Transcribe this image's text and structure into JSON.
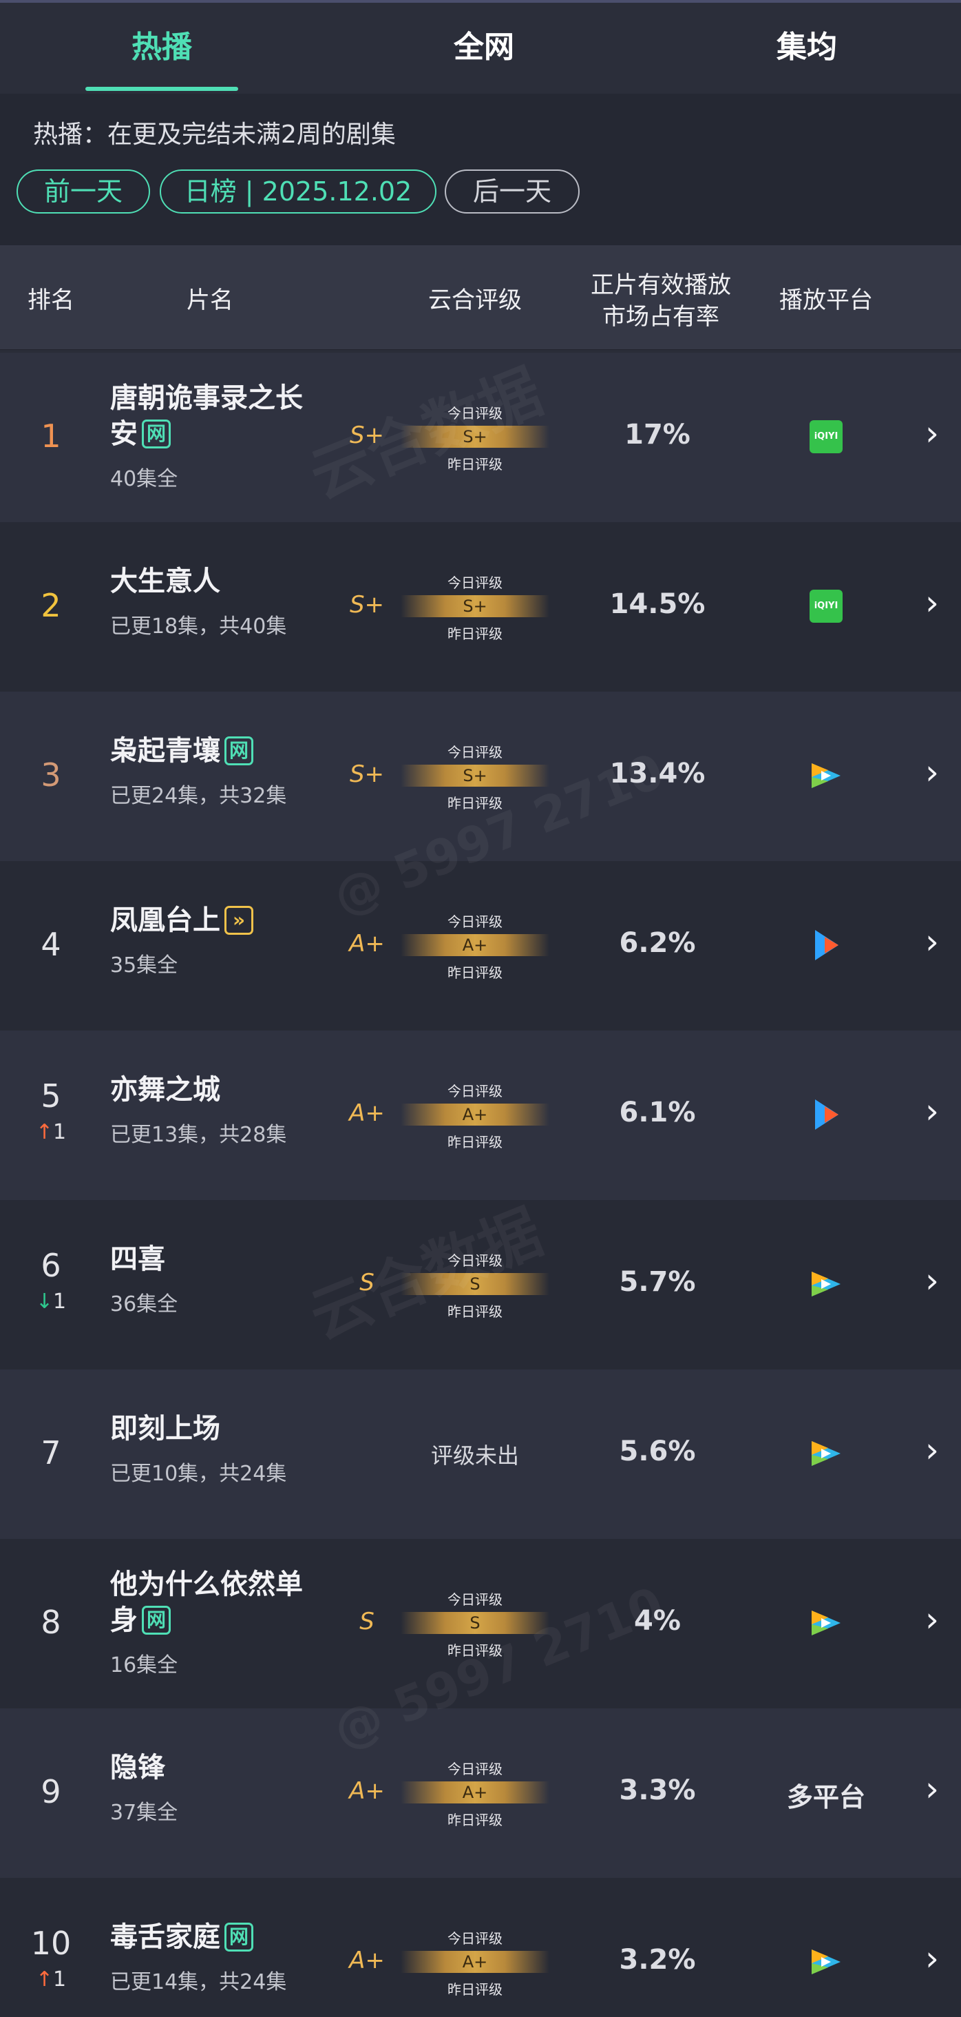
{
  "tabs": [
    {
      "label": "热播",
      "active": true
    },
    {
      "label": "全网",
      "active": false
    },
    {
      "label": "集均",
      "active": false
    }
  ],
  "subtitle": "热播：在更及完结未满2周的剧集",
  "date_nav": {
    "prev": "前一天",
    "current": "日榜 | 2025.12.02",
    "next": "后一天"
  },
  "columns": {
    "rank": "排名",
    "title": "片名",
    "grade": "云合评级",
    "share_line1": "正片有效播放",
    "share_line2": "市场占有率",
    "platform": "播放平台"
  },
  "grade_labels": {
    "today": "今日评级",
    "yesterday": "昨日评级"
  },
  "rows": [
    {
      "rank": "1",
      "title": "唐朝诡事录之长安",
      "badge": "网",
      "badge_type": "green",
      "episodes": "40集全",
      "grade_today": "S+",
      "grade_yesterday": "S+",
      "share": "17%",
      "platform": "iqiyi",
      "change": ""
    },
    {
      "rank": "2",
      "title": "大生意人",
      "badge": "",
      "episodes": "已更18集，共40集",
      "grade_today": "S+",
      "grade_yesterday": "S+",
      "share": "14.5%",
      "platform": "iqiyi",
      "change": ""
    },
    {
      "rank": "3",
      "title": "枭起青壤",
      "badge": "网",
      "badge_type": "green",
      "episodes": "已更24集，共32集",
      "grade_today": "S+",
      "grade_yesterday": "S+",
      "share": "13.4%",
      "platform": "tencent",
      "change": ""
    },
    {
      "rank": "4",
      "title": "凤凰台上",
      "badge": "»",
      "badge_type": "gold",
      "episodes": "35集全",
      "grade_today": "A+",
      "grade_yesterday": "A+",
      "share": "6.2%",
      "platform": "youku",
      "change": ""
    },
    {
      "rank": "5",
      "title": "亦舞之城",
      "badge": "",
      "episodes": "已更13集，共28集",
      "grade_today": "A+",
      "grade_yesterday": "A+",
      "share": "6.1%",
      "platform": "youku",
      "change": "1",
      "change_dir": "up"
    },
    {
      "rank": "6",
      "title": "四喜",
      "badge": "",
      "episodes": "36集全",
      "grade_today": "S",
      "grade_yesterday": "S",
      "share": "5.7%",
      "platform": "tencent",
      "change": "1",
      "change_dir": "down"
    },
    {
      "rank": "7",
      "title": "即刻上场",
      "badge": "",
      "episodes": "已更10集，共24集",
      "grade_text": "评级未出",
      "share": "5.6%",
      "platform": "tencent",
      "change": ""
    },
    {
      "rank": "8",
      "title": "他为什么依然单身",
      "badge": "网",
      "badge_type": "green",
      "episodes": "16集全",
      "grade_today": "S",
      "grade_yesterday": "S",
      "share": "4%",
      "platform": "tencent",
      "change": ""
    },
    {
      "rank": "9",
      "title": "隐锋",
      "badge": "",
      "episodes": "37集全",
      "grade_today": "A+",
      "grade_yesterday": "A+",
      "share": "3.3%",
      "platform_text": "多平台",
      "change": ""
    },
    {
      "rank": "10",
      "title": "毒舌家庭",
      "badge": "网",
      "badge_type": "green",
      "episodes": "已更14集，共24集",
      "grade_today": "A+",
      "grade_yesterday": "A+",
      "share": "3.2%",
      "platform": "tencent",
      "change": "1",
      "change_dir": "up"
    }
  ],
  "watermark_text": "云合数据",
  "watermark_id": "@ 5997 2710",
  "colors": {
    "accent": "#4fdfb5",
    "grade": "#f0b955",
    "up": "#ff6b3d",
    "down": "#2ec88e"
  }
}
